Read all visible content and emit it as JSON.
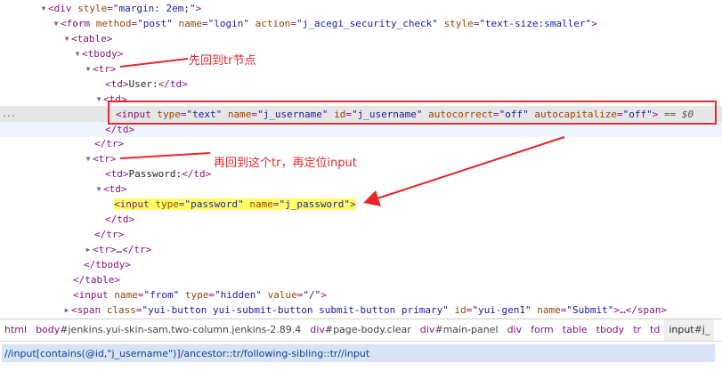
{
  "tree": {
    "row1": {
      "tag": "<div",
      "a1n": "style",
      "a1v": "\"margin: 2em;\"",
      "close": ">"
    },
    "row2": {
      "tag": "<form",
      "a1n": "method",
      "a1v": "\"post\"",
      "a2n": "name",
      "a2v": "\"login\"",
      "a3n": "action",
      "a3v": "\"j_acegi_security_check\"",
      "a4n": "style",
      "a4v": "\"text-size:smaller\"",
      "close": ">"
    },
    "row3": {
      "tag": "<table>"
    },
    "row4": {
      "tag": "<tbody>"
    },
    "row5": {
      "tag": "<tr>"
    },
    "row6": {
      "open": "<td>",
      "text": "User:",
      "close": "</td>"
    },
    "row7": {
      "tag": "<td>"
    },
    "row8": {
      "tag": "<input",
      "a1n": "type",
      "a1v": "\"text\"",
      "a2n": "name",
      "a2v": "\"j_username\"",
      "a3n": "id",
      "a3v": "\"j_username\"",
      "a4n": "autocorrect",
      "a4v": "\"off\"",
      "a5n": "autocapitalize",
      "a5v": "\"off\"",
      "close": ">",
      "eq": "== $0",
      "dots": "..."
    },
    "row9": {
      "tag": "</td>"
    },
    "row10": {
      "tag": "</tr>"
    },
    "row11": {
      "tag": "<tr>"
    },
    "row12": {
      "open": "<td>",
      "text": "Password:",
      "close": "</td>"
    },
    "row13": {
      "tag": "<td>"
    },
    "row14": {
      "tag": "<input",
      "a1n": "type",
      "a1v": "\"password\"",
      "a2n": "name",
      "a2v": "\"j_password\"",
      "close": ">"
    },
    "row15": {
      "tag": "</td>"
    },
    "row16": {
      "tag": "</tr>"
    },
    "row17": {
      "open": "<tr>",
      "text": "…",
      "close": "</tr>"
    },
    "row18": {
      "tag": "</tbody>"
    },
    "row19": {
      "tag": "</table>"
    },
    "row20": {
      "tag": "<input",
      "a1n": "name",
      "a1v": "\"from\"",
      "a2n": "type",
      "a2v": "\"hidden\"",
      "a3n": "value",
      "a3v": "\"/\"",
      "close": ">"
    },
    "row21": {
      "tag": "<span",
      "a1n": "class",
      "a1v": "\"yui-button yui-submit-button submit-button primary\"",
      "a2n": "id",
      "a2v": "\"yui-gen1\"",
      "a3n": "name",
      "a3v": "\"Submit\"",
      "close": ">…</span>"
    }
  },
  "toggles": {
    "open": "▼",
    "closed": "▶"
  },
  "breadcrumbs": [
    {
      "tag": "html",
      "id": ""
    },
    {
      "tag": "body",
      "id": "#jenkins.yui-skin-sam.two-column.jenkins-2.89.4"
    },
    {
      "tag": "div",
      "id": "#page-body.clear"
    },
    {
      "tag": "div",
      "id": "#main-panel"
    },
    {
      "tag": "div",
      "id": ""
    },
    {
      "tag": "form",
      "id": ""
    },
    {
      "tag": "table",
      "id": ""
    },
    {
      "tag": "tbody",
      "id": ""
    },
    {
      "tag": "tr",
      "id": ""
    },
    {
      "tag": "td",
      "id": ""
    },
    {
      "tag": "input",
      "id": "#j_"
    }
  ],
  "xpath": {
    "value": "//input[contains(@id,\"j_username\")]/ancestor::tr/following-sibling::tr//input"
  },
  "annotations": {
    "note1": "先回到tr节点",
    "note2": "再回到这个tr，再定位input"
  },
  "colors": {
    "annotation": "#e8262b",
    "highlight": "#ffff66",
    "xpath_bg": "#d6e4f5"
  }
}
